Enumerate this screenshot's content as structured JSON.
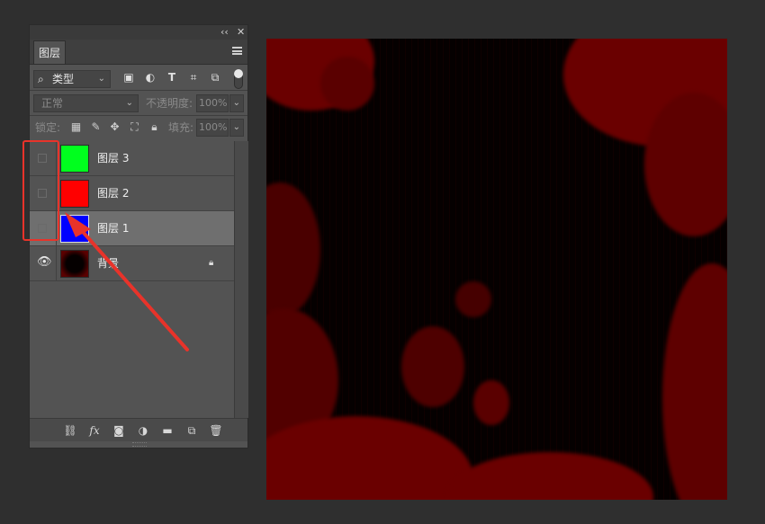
{
  "panel": {
    "tab_label": "图层",
    "collapse_glyph": "‹‹",
    "close_glyph": "✕",
    "filter": {
      "selected": "类型",
      "search_glyph": "⌕",
      "icons": [
        "image-filter-icon",
        "adjustment-filter-icon",
        "type-filter-icon",
        "shape-filter-icon",
        "smart-object-filter-icon"
      ]
    },
    "blend_mode": "正常",
    "opacity_label": "不透明度:",
    "opacity_value": "100%",
    "lock_label": "锁定:",
    "fill_label": "填充:",
    "fill_value": "100%",
    "layers": [
      {
        "name": "图层 3",
        "color": "#00ff1e",
        "visible": false,
        "selected": false
      },
      {
        "name": "图层 2",
        "color": "#ff0000",
        "visible": false,
        "selected": false
      },
      {
        "name": "图层 1",
        "color": "#0000ff",
        "visible": false,
        "selected": true
      },
      {
        "name": "背景",
        "color": "#3a0000",
        "visible": true,
        "selected": false,
        "locked": true
      }
    ],
    "bottom_icons": [
      "link-icon",
      "fx-icon",
      "mask-icon",
      "adjustment-icon",
      "folder-icon",
      "new-layer-icon",
      "trash-icon"
    ],
    "fx_label": "fx"
  },
  "annotation": {
    "highlight_color": "#e8332a",
    "arrow_color": "#e8332a"
  },
  "canvas": {
    "base_color": "#050000",
    "splatter_color": "#6a0000"
  }
}
